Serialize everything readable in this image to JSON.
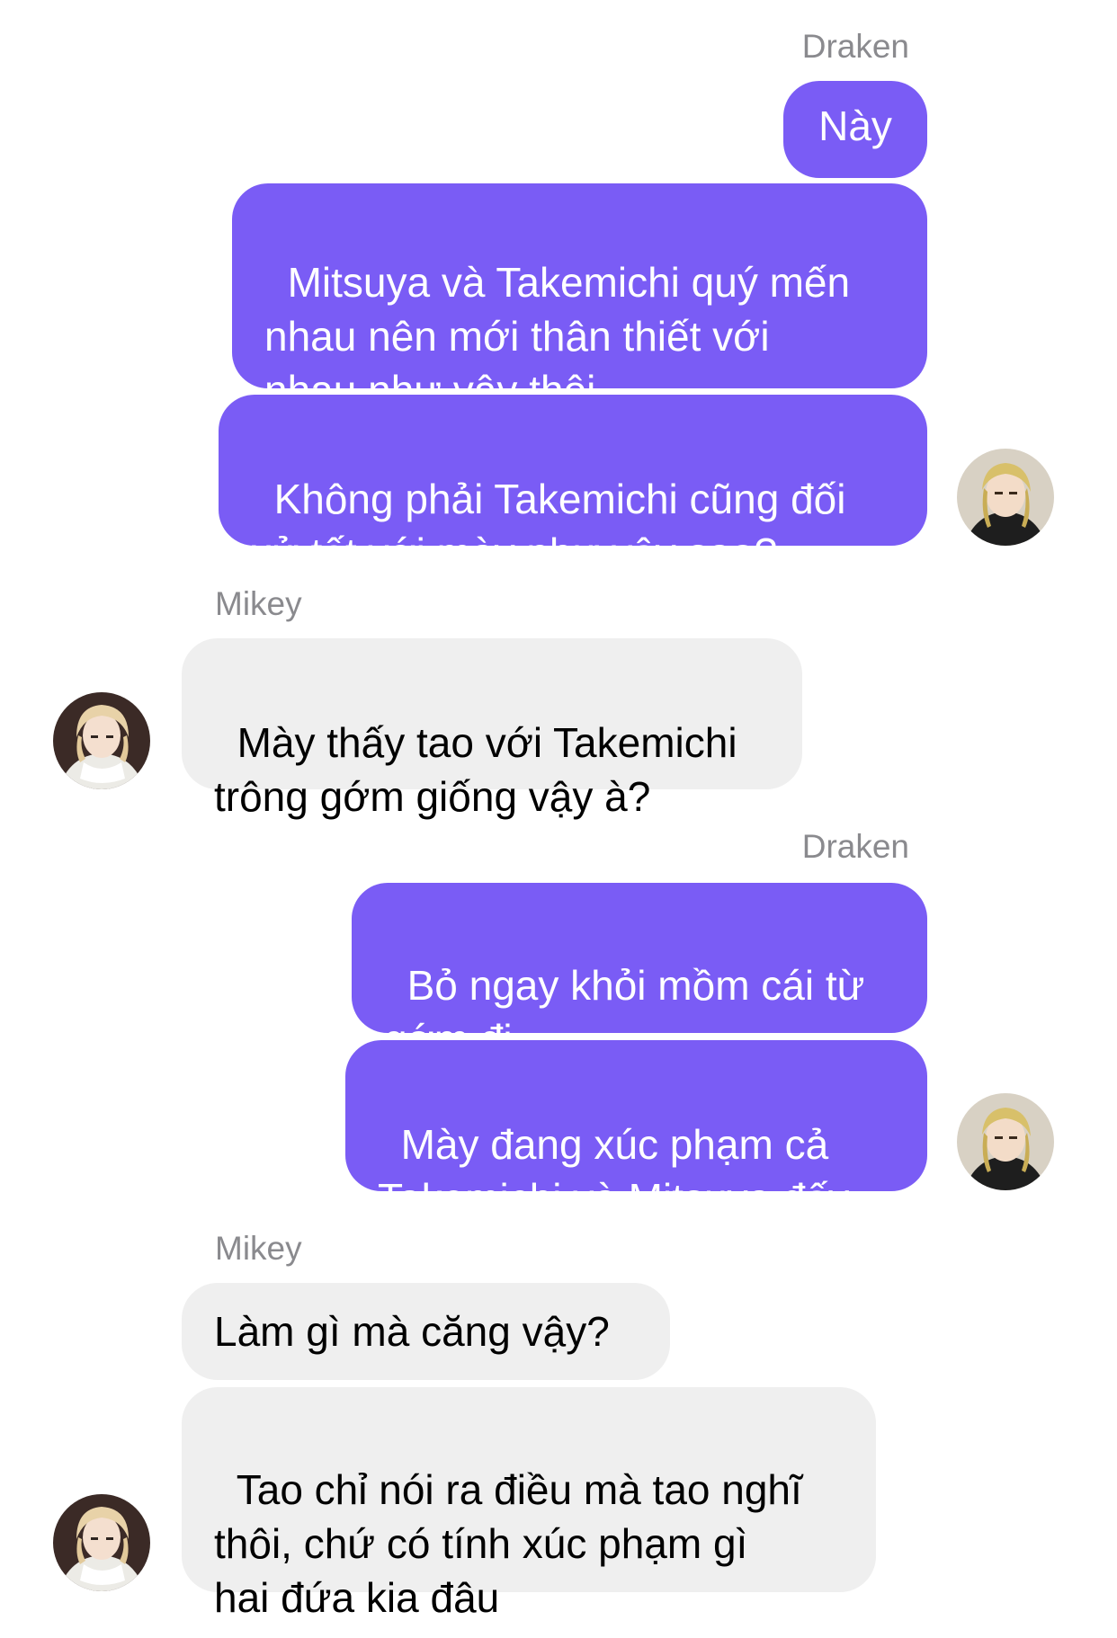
{
  "chat": {
    "groups": [
      {
        "sender": "Draken",
        "messages": [
          "Này",
          "Mitsuya và Takemichi quý mến\nnhau nên mới thân thiết với\nnhau như vậy thôi",
          "Không phải Takemichi cũng đối\nxử tốt với mày như vậy sao?"
        ]
      },
      {
        "sender": "Mikey",
        "messages": [
          "Mày thấy tao với Takemichi\ntrông gớm giống vậy à?"
        ]
      },
      {
        "sender": "Draken",
        "messages": [
          "Bỏ ngay khỏi mồm cái từ\ngớm đi",
          "Mày đang xúc phạm cả\nTakemichi và Mitsuya đấy"
        ]
      },
      {
        "sender": "Mikey",
        "messages": [
          "Làm gì mà căng vậy?",
          "Tao chỉ nói ra điều mà tao nghĩ\nthôi, chứ có tính xúc phạm gì\nhai đứa kia đâu"
        ]
      }
    ]
  },
  "colors": {
    "outgoing_bubble": "#7a5cf5",
    "incoming_bubble": "#efefef",
    "sender_name": "#8a8a8e"
  }
}
